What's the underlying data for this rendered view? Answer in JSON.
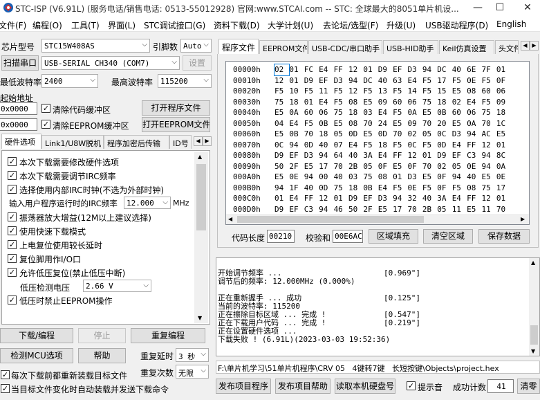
{
  "window": {
    "title": "STC-ISP (V6.91L) (服务电话/销售电话: 0513-55012928) 官网:www.STCAI.com  -- STC: 全球最大的8051单片机设...",
    "minimize": "—",
    "maximize": "☐",
    "close": "✕"
  },
  "menu": [
    "文件(F)",
    "编程(O)",
    "工具(T)",
    "界面(L)",
    "STC调试接口(G)",
    "资料下载(D)",
    "大学计划(U)",
    "去论坛/选型(F)",
    "升级(U)",
    "USB驱动程序(D)",
    "English"
  ],
  "left": {
    "chip_label": "芯片型号",
    "chip_value": "STC15W408AS",
    "pin_label": "引脚数",
    "pin_value": "Auto",
    "scan_button": "扫描串口",
    "port_value": "USB-SERIAL CH340 (COM7)",
    "settings_button": "设置",
    "min_baud_label": "最低波特率",
    "min_baud_value": "2400",
    "max_baud_label": "最高波特率",
    "max_baud_value": "115200",
    "start_addr_label": "起始地址",
    "addr1_value": "0x0000",
    "clear_code_label": "清除代码缓冲区",
    "open_program_button": "打开程序文件",
    "addr2_value": "0x0000",
    "clear_eeprom_label": "清除EEPROM缓冲区",
    "open_eeprom_button": "打开EEPROM文件",
    "tabs": [
      "硬件选项",
      "Link1/U8W脱机",
      "程序加密后传输",
      "ID号"
    ],
    "options": [
      {
        "label": "本次下载需要修改硬件选项",
        "checked": true
      },
      {
        "label": "本次下载需要调节IRC频率",
        "checked": true
      },
      {
        "label": "选择使用内部IRC时钟(不选为外部时钟)",
        "checked": true
      }
    ],
    "irc_label": "输入用户程序运行时的IRC频率",
    "irc_value": "12.000",
    "irc_unit": "MHz",
    "options2": [
      {
        "label": "振荡器放大增益(12M以上建议选择)",
        "checked": true
      },
      {
        "label": "使用快速下载模式",
        "checked": true
      },
      {
        "label": "上电复位使用较长延时",
        "checked": true
      },
      {
        "label": "复位脚用作I/O口",
        "checked": true
      },
      {
        "label": "允许低压复位(禁止低压中断)",
        "checked": true
      }
    ],
    "lv_label": "低压检测电压",
    "lv_value": "2.66 V",
    "option_last": {
      "label": "低压时禁止EEPROM操作",
      "checked": true
    },
    "download_button": "下载/编程",
    "stop_button": "停止",
    "reprogram_button": "重复编程",
    "detect_button": "检测MCU选项",
    "help_button": "帮助",
    "repeat_delay_label": "重复延时",
    "repeat_delay_value": "3 秒",
    "repeat_count_label": "重复次数",
    "repeat_count_value": "无限",
    "reload_label": "每次下载前都重新装载目标文件",
    "auto_label": "当目标文件变化时自动装载并发送下载命令"
  },
  "right": {
    "tabs": [
      "程序文件",
      "EEPROM文件",
      "USB-CDC/串口助手",
      "USB-HID助手",
      "Keil仿真设置",
      "头文件"
    ],
    "hex_rows": [
      {
        "addr": "00000h",
        "bytes": [
          "02",
          "01",
          "FC",
          "E4",
          "FF",
          "12",
          "01",
          "D9",
          "EF",
          "D3",
          "94",
          "DC",
          "40",
          "6E",
          "7F",
          "01"
        ]
      },
      {
        "addr": "00010h",
        "bytes": [
          "12",
          "01",
          "D9",
          "EF",
          "D3",
          "94",
          "DC",
          "40",
          "63",
          "E4",
          "F5",
          "17",
          "F5",
          "0E",
          "F5",
          "0F"
        ]
      },
      {
        "addr": "00020h",
        "bytes": [
          "F5",
          "10",
          "F5",
          "11",
          "F5",
          "12",
          "F5",
          "13",
          "F5",
          "14",
          "F5",
          "15",
          "E5",
          "08",
          "60",
          "06"
        ]
      },
      {
        "addr": "00030h",
        "bytes": [
          "75",
          "18",
          "01",
          "E4",
          "F5",
          "08",
          "E5",
          "09",
          "60",
          "06",
          "75",
          "18",
          "02",
          "E4",
          "F5",
          "09"
        ]
      },
      {
        "addr": "00040h",
        "bytes": [
          "E5",
          "0A",
          "60",
          "06",
          "75",
          "18",
          "03",
          "E4",
          "F5",
          "0A",
          "E5",
          "0B",
          "60",
          "06",
          "75",
          "18"
        ]
      },
      {
        "addr": "00050h",
        "bytes": [
          "04",
          "E4",
          "F5",
          "0B",
          "E5",
          "08",
          "70",
          "24",
          "E5",
          "09",
          "70",
          "20",
          "E5",
          "0A",
          "70",
          "1C"
        ]
      },
      {
        "addr": "00060h",
        "bytes": [
          "E5",
          "0B",
          "70",
          "18",
          "05",
          "0D",
          "E5",
          "0D",
          "70",
          "02",
          "05",
          "0C",
          "D3",
          "94",
          "AC",
          "E5"
        ]
      },
      {
        "addr": "00070h",
        "bytes": [
          "0C",
          "94",
          "0D",
          "40",
          "07",
          "E4",
          "F5",
          "18",
          "F5",
          "0C",
          "F5",
          "0D",
          "E4",
          "FF",
          "12",
          "01"
        ]
      },
      {
        "addr": "00080h",
        "bytes": [
          "D9",
          "EF",
          "D3",
          "94",
          "64",
          "40",
          "3A",
          "E4",
          "FF",
          "12",
          "01",
          "D9",
          "EF",
          "C3",
          "94",
          "8C"
        ]
      },
      {
        "addr": "00090h",
        "bytes": [
          "50",
          "2F",
          "E5",
          "17",
          "70",
          "2B",
          "05",
          "0F",
          "E5",
          "0F",
          "70",
          "02",
          "05",
          "0E",
          "94",
          "0A"
        ]
      },
      {
        "addr": "000A0h",
        "bytes": [
          "E5",
          "0E",
          "94",
          "00",
          "40",
          "03",
          "75",
          "08",
          "01",
          "D3",
          "E5",
          "0F",
          "94",
          "40",
          "E5",
          "0E"
        ]
      },
      {
        "addr": "000B0h",
        "bytes": [
          "94",
          "1F",
          "40",
          "0D",
          "75",
          "18",
          "0B",
          "E4",
          "F5",
          "0E",
          "F5",
          "0F",
          "F5",
          "08",
          "75",
          "17"
        ]
      },
      {
        "addr": "000C0h",
        "bytes": [
          "01",
          "E4",
          "FF",
          "12",
          "01",
          "D9",
          "EF",
          "D3",
          "94",
          "32",
          "40",
          "3A",
          "E4",
          "FF",
          "12",
          "01"
        ]
      },
      {
        "addr": "000D0h",
        "bytes": [
          "D9",
          "EF",
          "C3",
          "94",
          "46",
          "50",
          "2F",
          "E5",
          "17",
          "70",
          "2B",
          "05",
          "11",
          "E5",
          "11",
          "70"
        ]
      }
    ],
    "code_len_label": "代码长度",
    "code_len_value": "00210",
    "checksum_label": "校验和",
    "checksum_value": "00E6AC",
    "fill_button": "区域填充",
    "clear_button": "清空区域",
    "save_button": "保存数据",
    "log": [
      {
        "text": "开始调节频率 ...",
        "value": "[0.969\"]"
      },
      {
        "text": "调节后的频率: 12.000MHz (0.000%)",
        "value": ""
      },
      {
        "text": "",
        "value": ""
      },
      {
        "text": "正在重新握手 ... 成功",
        "value": "[0.125\"]"
      },
      {
        "text": "当前的波特率: 115200",
        "value": ""
      },
      {
        "text": "正在擦除目标区域 ... 完成 !",
        "value": "[0.547\"]"
      },
      {
        "text": "正在下载用户代码 ... 完成 !",
        "value": "[0.219\"]"
      },
      {
        "text": "正在设置硬件选项 ...",
        "value": ""
      },
      {
        "text": "下载失败 ! (6.91L)(2023-03-03 19:52:36)",
        "value": ""
      }
    ],
    "status_path": "F:\\单片机学习\\51单片机程序\\CRV 05   4键转7键   长短按键\\Objects\\project.hex",
    "publish_project_button": "发布项目程序",
    "publish_help_button": "发布项目帮助",
    "read_disk_button": "读取本机硬盘号",
    "prompt_sound_label": "提示音",
    "success_count_label": "成功计数",
    "success_count_value": "41",
    "clear_count_button": "清零"
  },
  "colors": {
    "window_bg": "#f0f0f0",
    "title_bg": "#ffffff",
    "selection": "#0078d7",
    "logo_blue": "#1a5fb4",
    "logo_red": "#d32f2f"
  }
}
